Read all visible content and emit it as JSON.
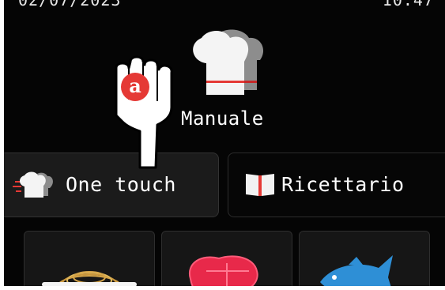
{
  "status_bar": {
    "date": "02/07/2023",
    "time": "10:47"
  },
  "mode": {
    "label": "Manuale",
    "icon": "chef-hat-icon"
  },
  "callout": {
    "badge": "a",
    "icon": "hand-pointer-icon",
    "badge_color": "#e53935"
  },
  "tabs": [
    {
      "label": "One touch",
      "icon": "chef-hat-fast-icon",
      "active": true
    },
    {
      "label": "Ricettario",
      "icon": "open-book-icon",
      "active": false
    }
  ],
  "categories": [
    {
      "icon": "pasta-icon"
    },
    {
      "icon": "meat-icon",
      "color": "#e8294a"
    },
    {
      "icon": "fish-icon",
      "color": "#2e8fd6"
    }
  ],
  "colors": {
    "background": "#050505",
    "accent_red": "#e53935",
    "text": "#ffffff"
  }
}
